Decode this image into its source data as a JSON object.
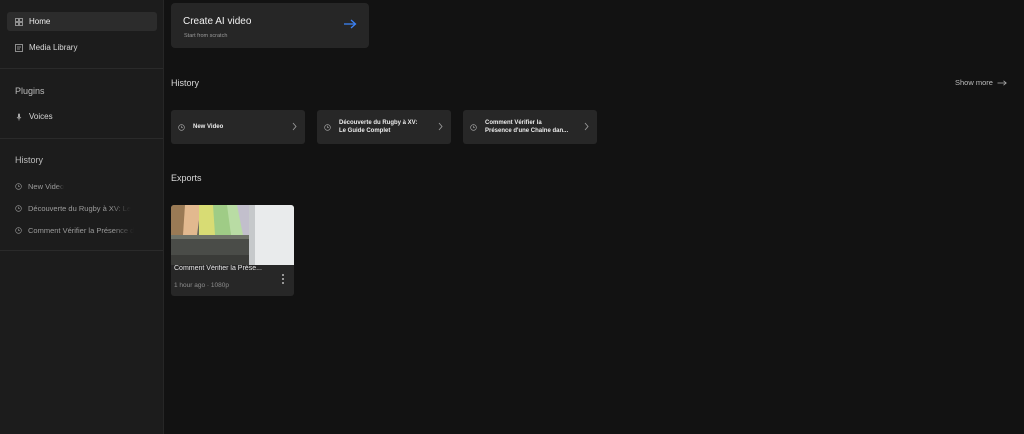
{
  "sidebar": {
    "nav": [
      {
        "label": "Home",
        "icon": "home-grid-icon",
        "active": true
      },
      {
        "label": "Media Library",
        "icon": "media-library-icon",
        "active": false
      }
    ],
    "plugins_title": "Plugins",
    "plugins": [
      {
        "label": "Voices",
        "icon": "microphone-icon"
      }
    ],
    "history_title": "History",
    "history": [
      {
        "label": "New Video"
      },
      {
        "label": "Découverte du Rugby à XV: Le"
      },
      {
        "label": "Comment Vérifier la Présence d"
      }
    ]
  },
  "main": {
    "create": {
      "title": "Create AI video",
      "subtitle": "Start from scratch"
    },
    "history": {
      "title": "History",
      "show_more": "Show more",
      "cards": [
        {
          "line1": "New Video",
          "line2": ""
        },
        {
          "line1": "Découverte du Rugby à XV:",
          "line2": "Le Guide Complet"
        },
        {
          "line1": "Comment Vérifier la",
          "line2": "Présence d'une Chaîne dan..."
        }
      ]
    },
    "exports": {
      "title": "Exports",
      "items": [
        {
          "title": "Comment Vérifier la Prése...",
          "meta": "1 hour ago · 1080p"
        }
      ]
    }
  },
  "colors": {
    "background": "#121212",
    "sidebar": "#1c1c1c",
    "card": "#272727",
    "accent": "#3b82f6"
  }
}
